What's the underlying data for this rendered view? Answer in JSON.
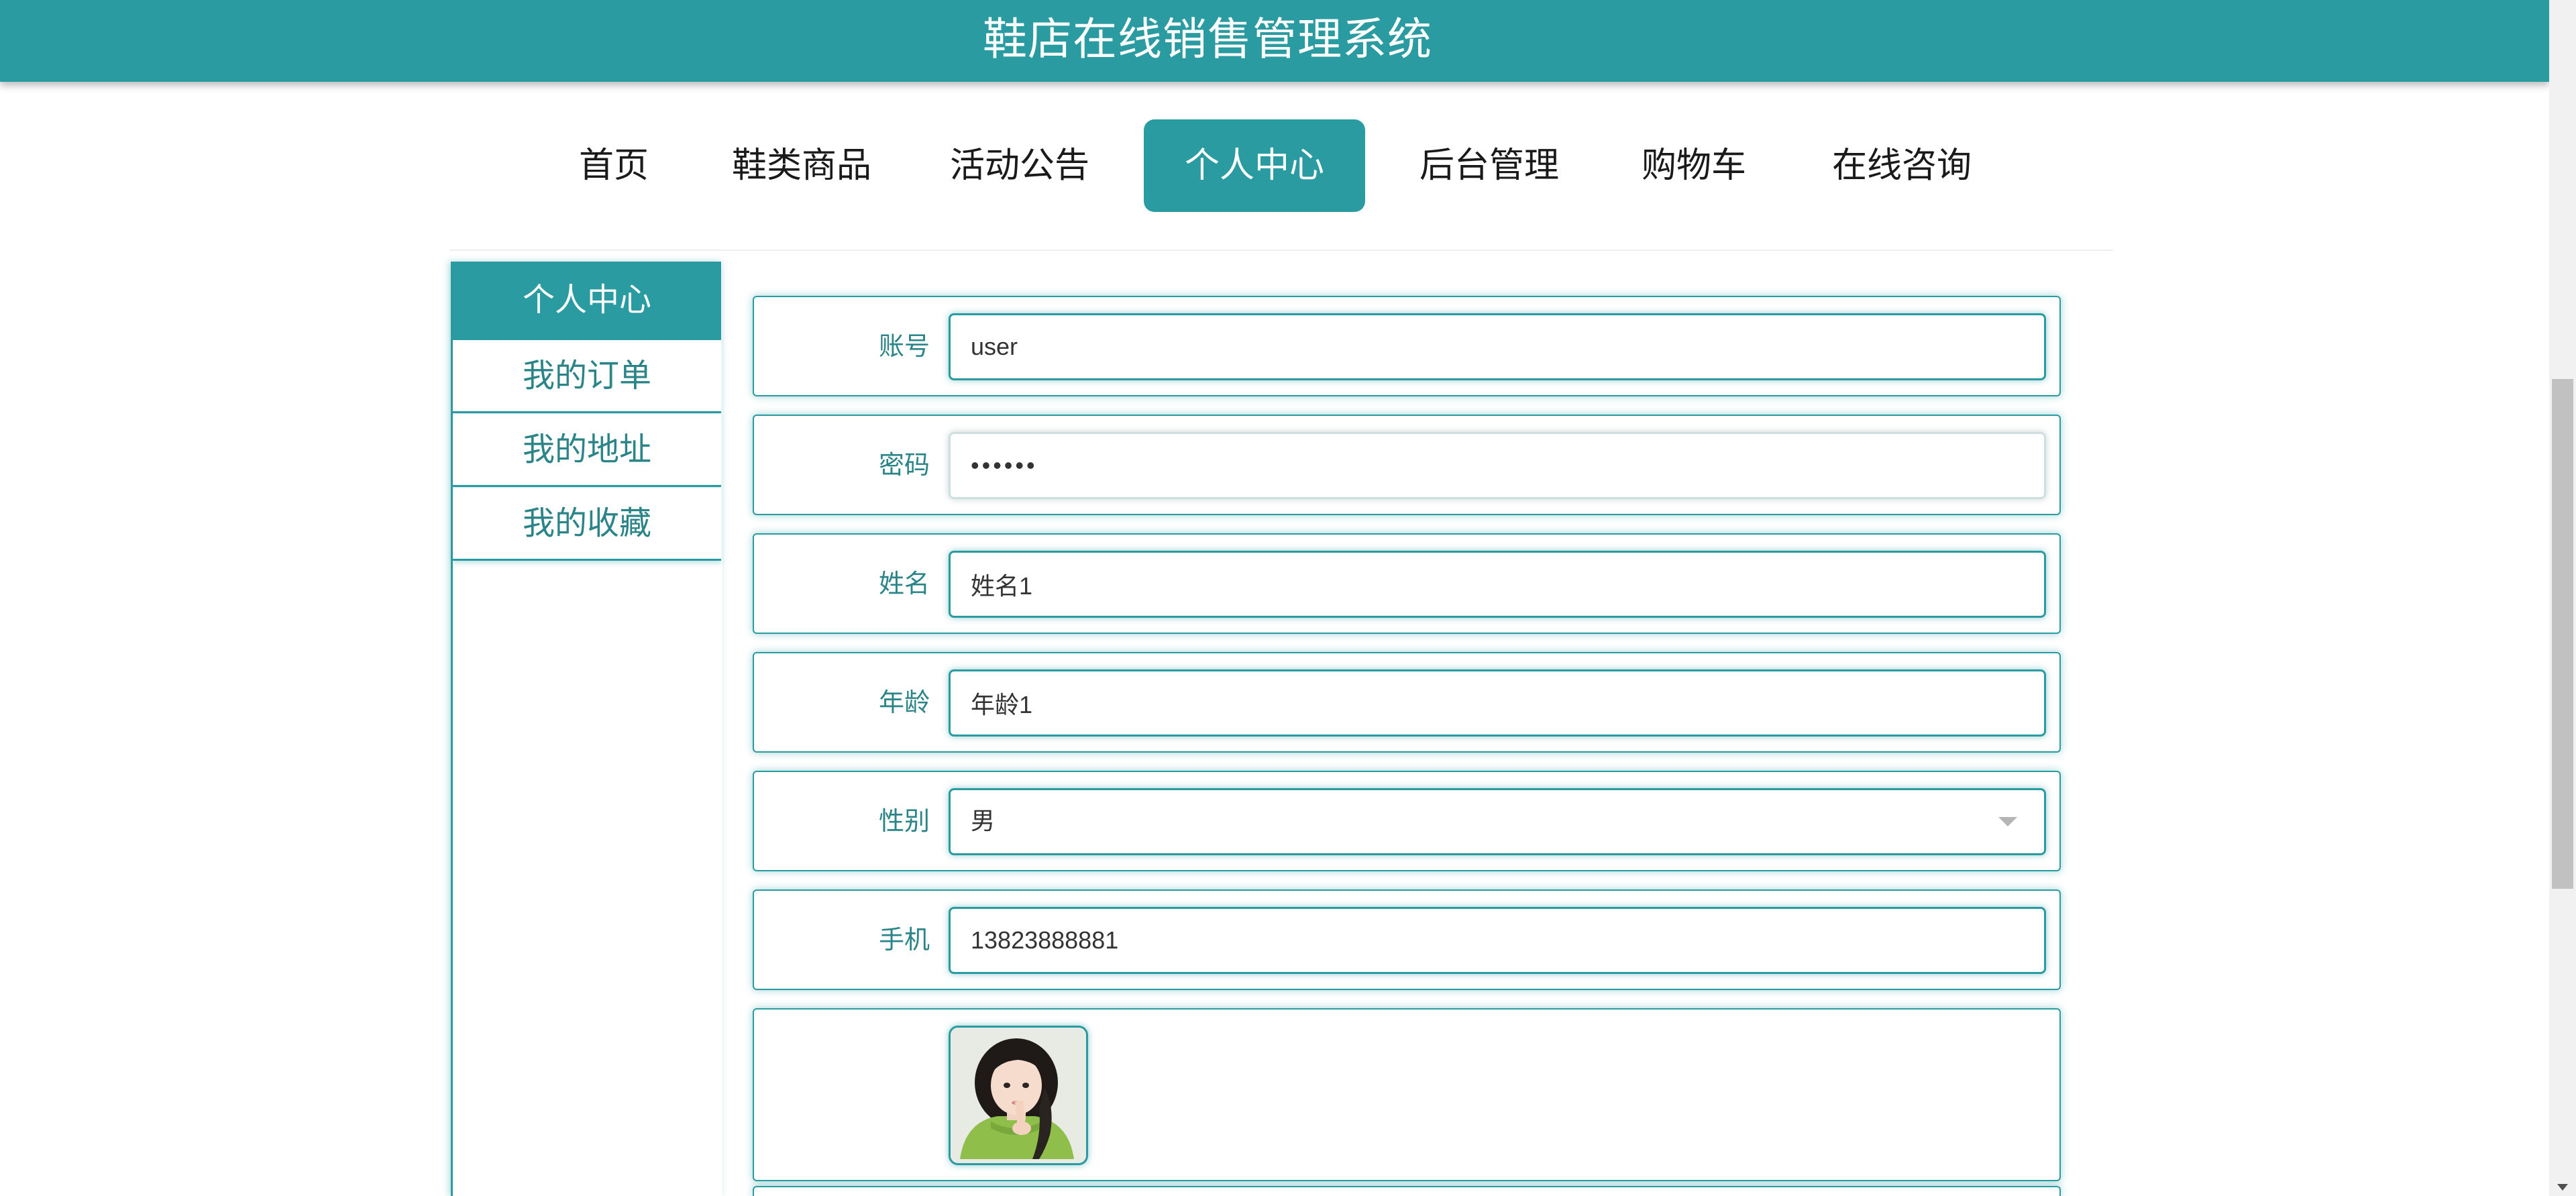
{
  "header": {
    "title": "鞋店在线销售管理系统"
  },
  "nav": {
    "items": [
      {
        "label": "首页"
      },
      {
        "label": "鞋类商品"
      },
      {
        "label": "活动公告"
      },
      {
        "label": "个人中心"
      },
      {
        "label": "后台管理"
      },
      {
        "label": "购物车"
      },
      {
        "label": "在线咨询"
      }
    ],
    "active_index": 3
  },
  "sidebar": {
    "items": [
      {
        "label": "个人中心"
      },
      {
        "label": "我的订单"
      },
      {
        "label": "我的地址"
      },
      {
        "label": "我的收藏"
      }
    ],
    "active_index": 0
  },
  "form": {
    "account": {
      "label": "账号",
      "value": "user"
    },
    "password": {
      "label": "密码",
      "value": "••••••"
    },
    "name": {
      "label": "姓名",
      "value": "姓名1"
    },
    "age": {
      "label": "年龄",
      "value": "年龄1"
    },
    "gender": {
      "label": "性别",
      "value": "男"
    },
    "phone": {
      "label": "手机",
      "value": "13823888881"
    }
  },
  "icons": {
    "avatar": "user-photo",
    "select_caret": "chevron-down-icon",
    "scroll_down": "scroll-down-arrow"
  },
  "colors": {
    "primary": "#2a9ba0",
    "label_text": "#2a8488"
  }
}
